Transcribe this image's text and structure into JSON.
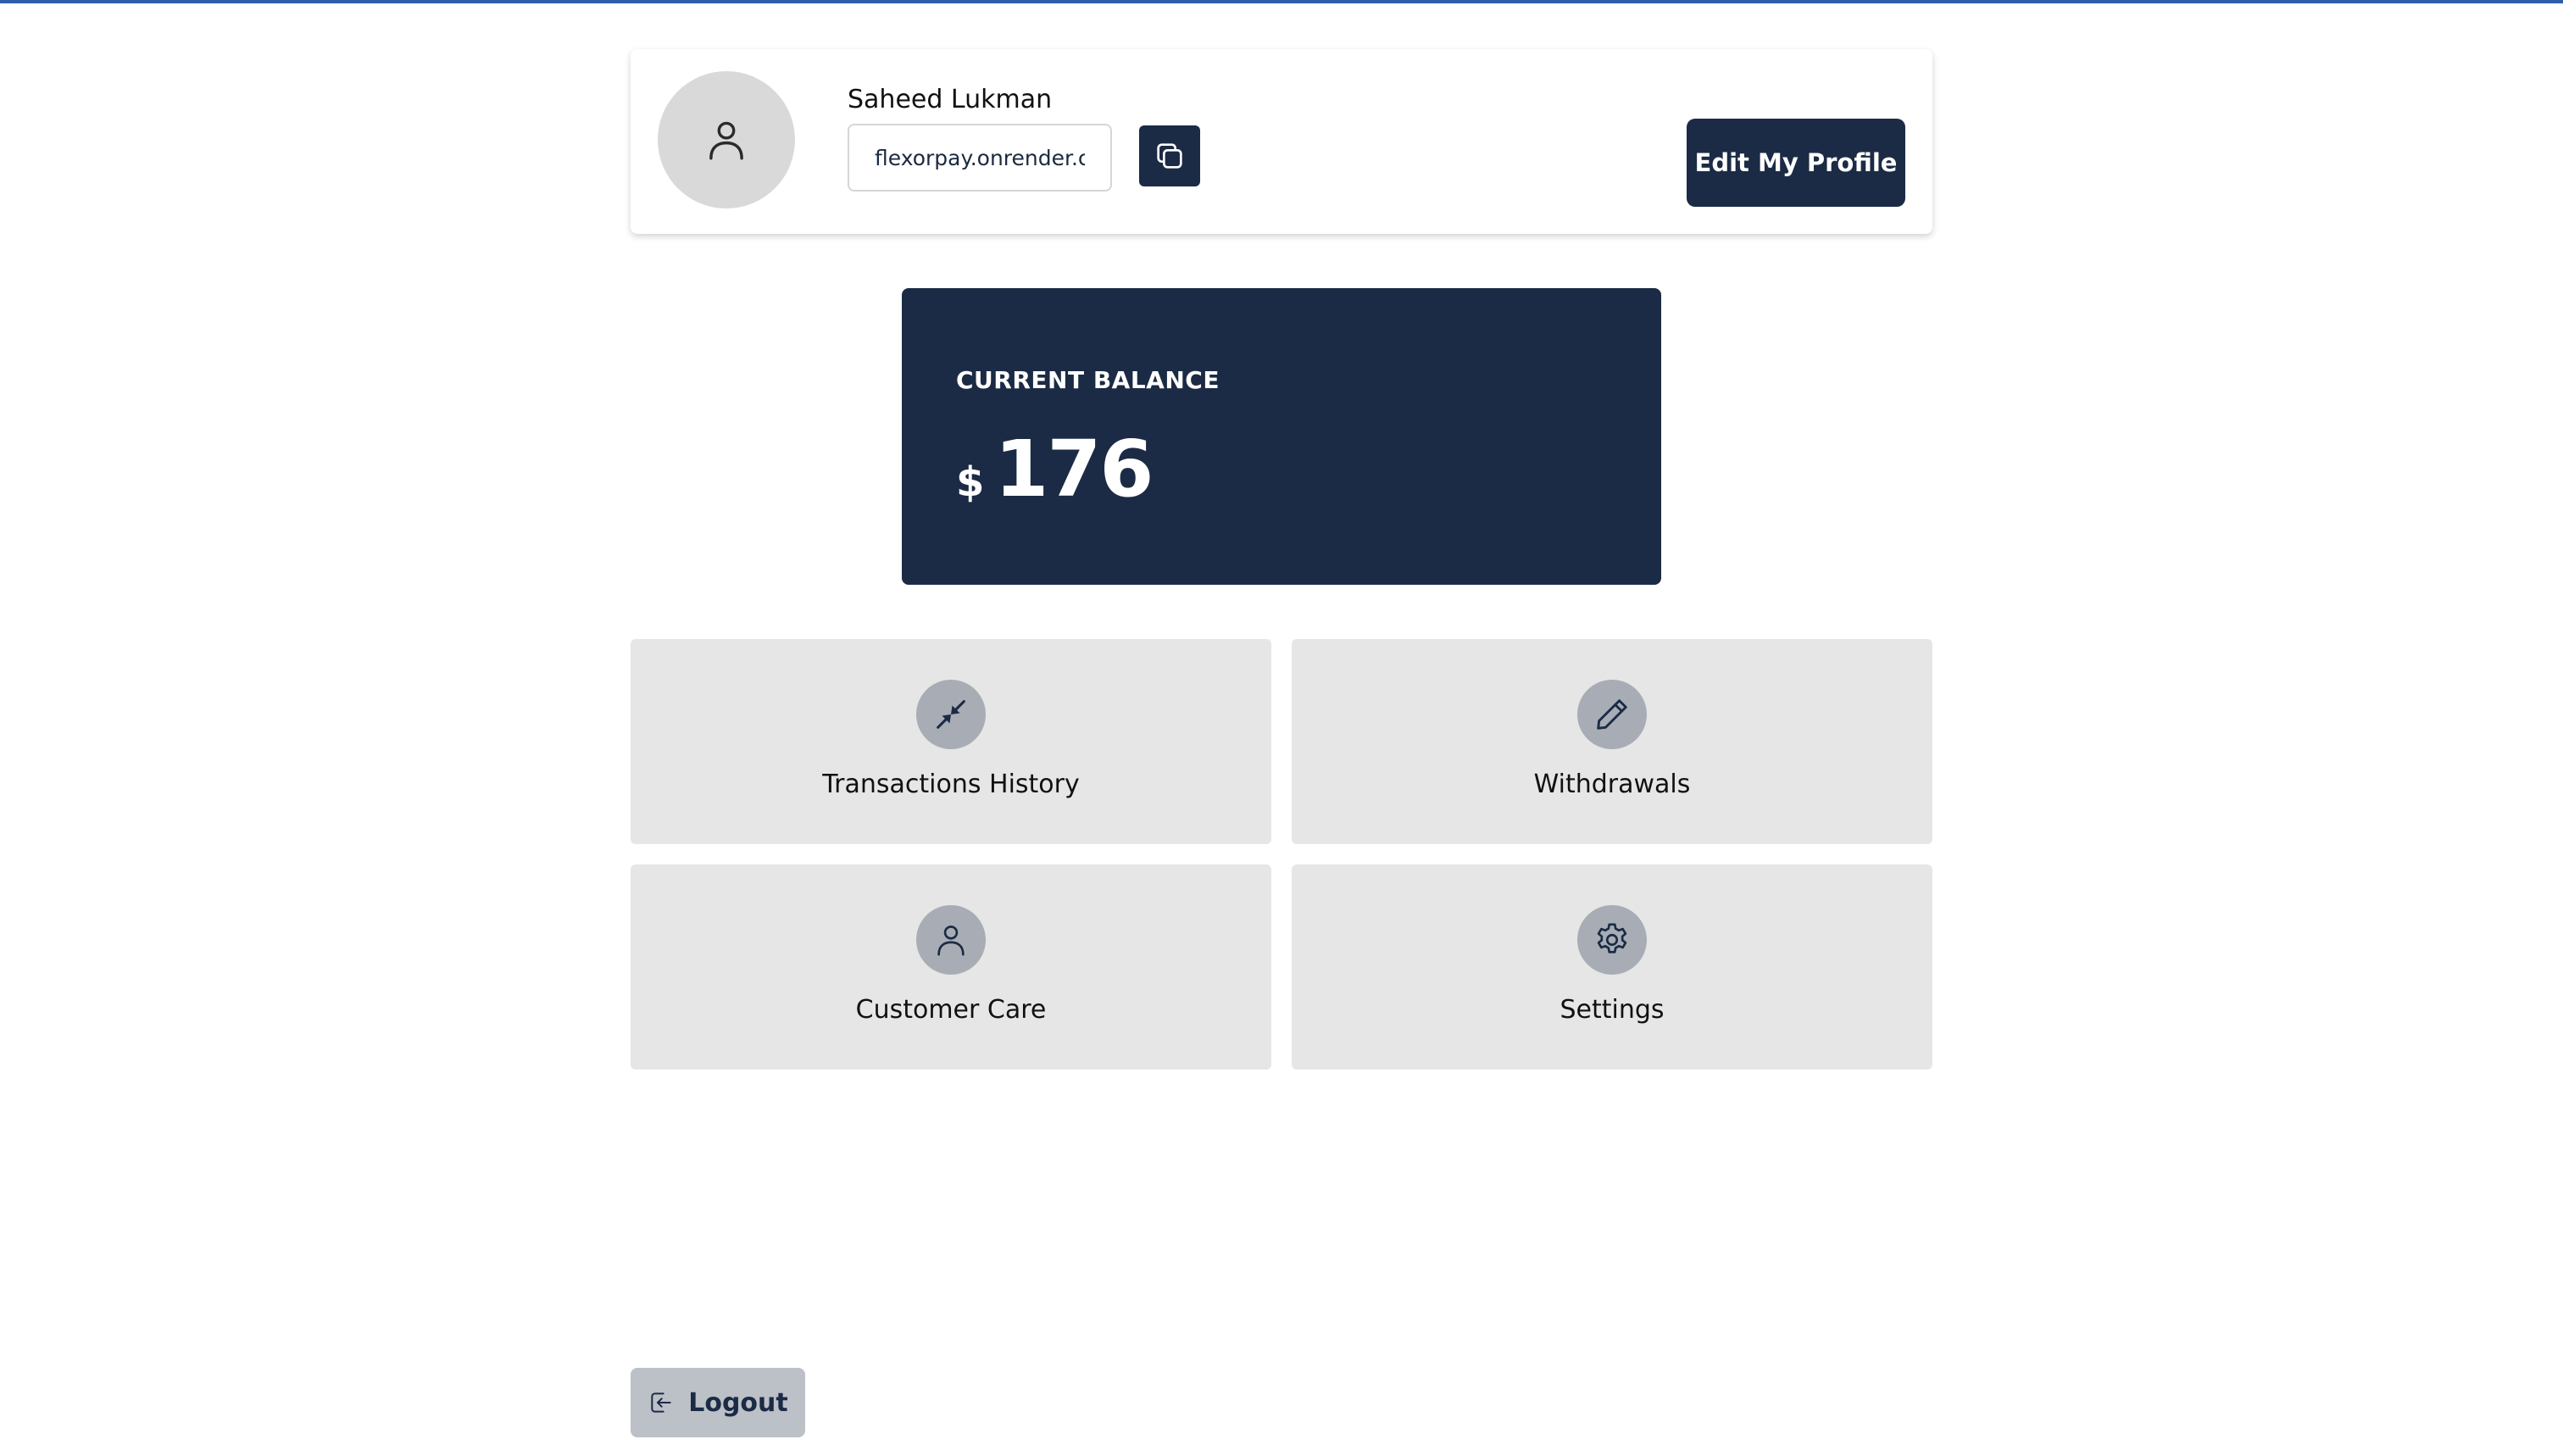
{
  "profile": {
    "name": "Saheed Lukman",
    "link_value": "flexorpay.onrender.c",
    "edit_label": "Edit My Profile",
    "avatar_icon": "user-icon",
    "copy_icon": "copy-icon"
  },
  "balance": {
    "label": "CURRENT BALANCE",
    "currency": "$",
    "amount": "176"
  },
  "tiles": [
    {
      "label": "Transactions History",
      "icon": "arrows-in-icon"
    },
    {
      "label": "Withdrawals",
      "icon": "pencil-icon"
    },
    {
      "label": "Customer Care",
      "icon": "user-icon"
    },
    {
      "label": "Settings",
      "icon": "gear-icon"
    }
  ],
  "logout": {
    "label": "Logout",
    "icon": "logout-icon"
  },
  "colors": {
    "primary": "#1b2b45",
    "tile_bg": "#e6e6e6",
    "icon_circle": "#a8adb5",
    "logout_bg": "#bcc0c7",
    "top_line": "#2f5ea8"
  }
}
